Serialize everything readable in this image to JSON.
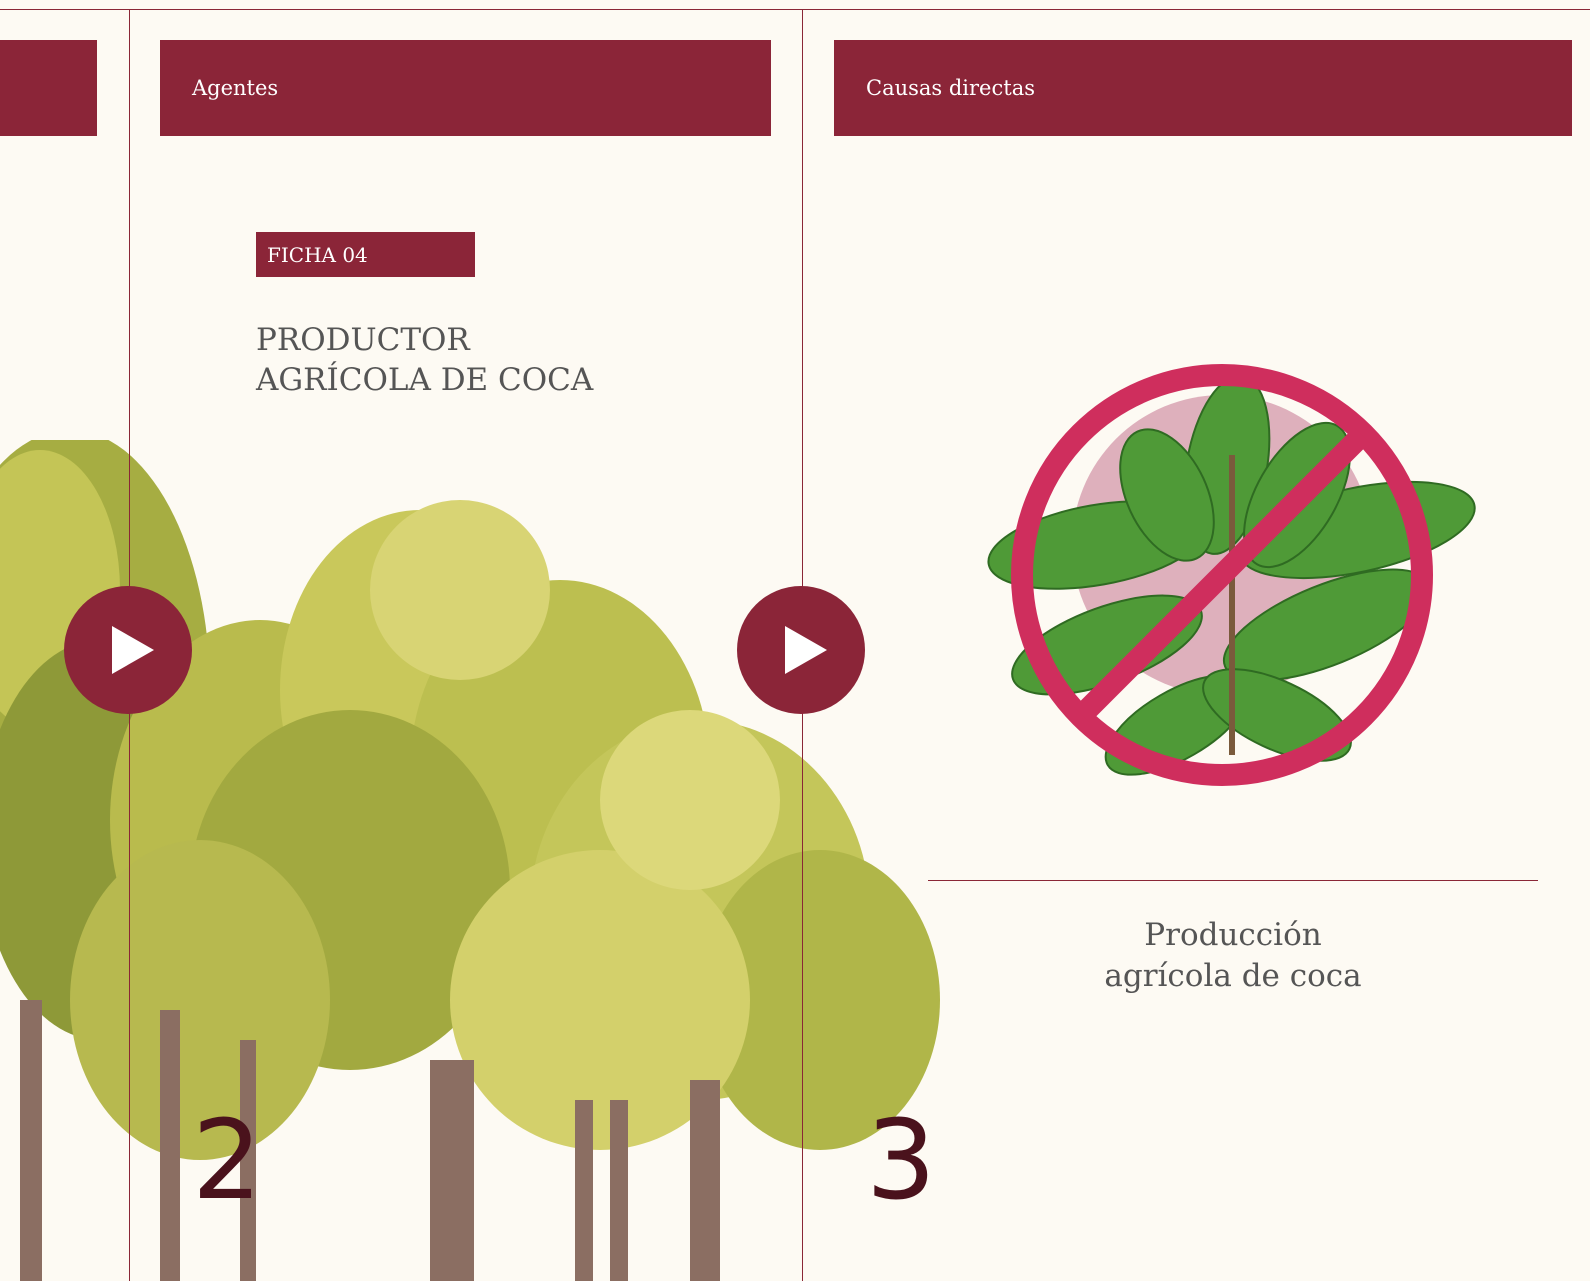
{
  "headers": {
    "agentes": "Agentes",
    "causas": "Causas directas"
  },
  "ficha": {
    "label": "FICHA 04",
    "title_line1": "PRODUCTOR",
    "title_line2": "AGRÍCOLA DE COCA"
  },
  "cause": {
    "caption_line1": "Producción",
    "caption_line2": "agrícola de coca"
  },
  "page_numbers": {
    "left": "2",
    "right": "3"
  },
  "icons": [
    "play-icon",
    "no-coca-icon"
  ],
  "colors": {
    "accent": "#8b2538",
    "page_number": "#4a121c",
    "background": "#fdfaf3"
  }
}
